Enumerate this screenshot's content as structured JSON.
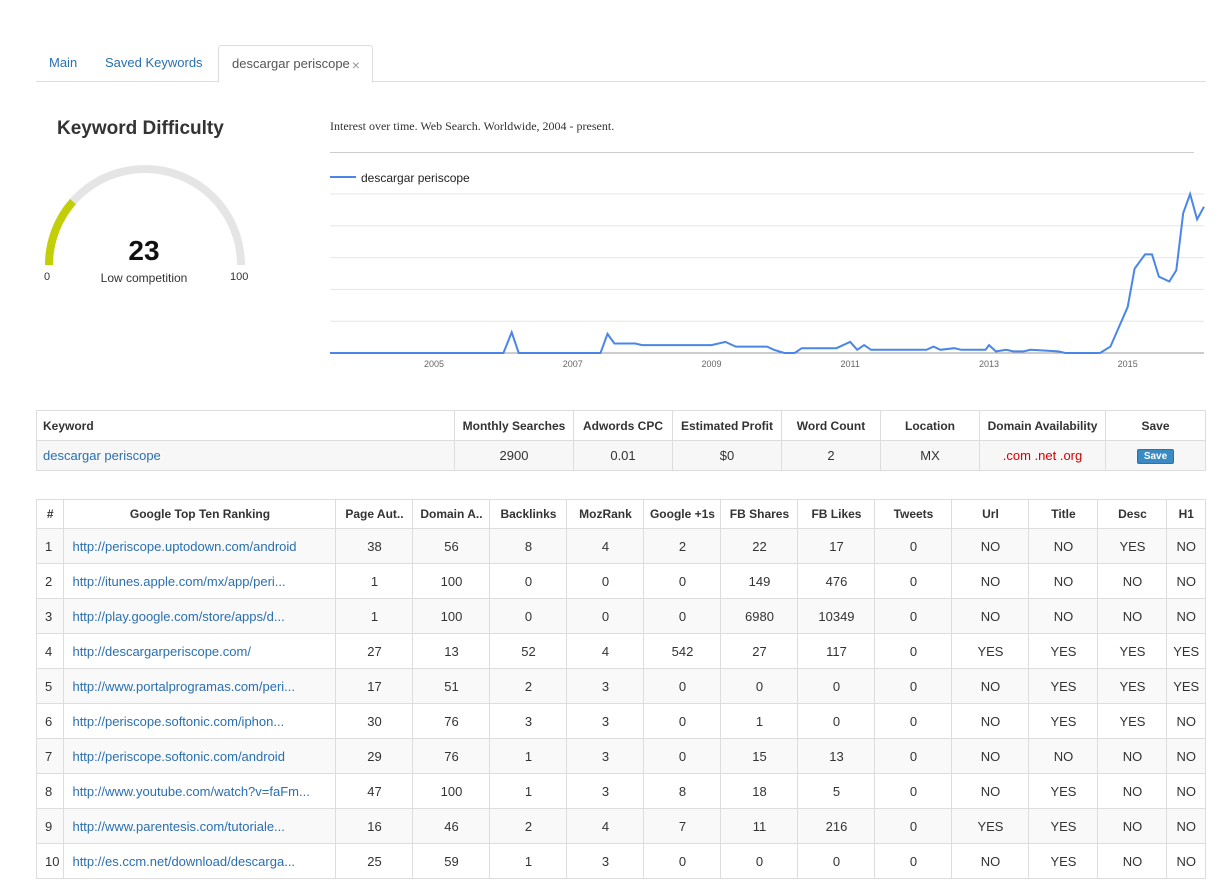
{
  "tabs": [
    {
      "label": "Main"
    },
    {
      "label": "Saved Keywords"
    },
    {
      "label": "descargar periscope",
      "close": "×"
    }
  ],
  "kd": {
    "title": "Keyword Difficulty",
    "value": "23",
    "fraction": 0.23,
    "label": "Low competition",
    "min": "0",
    "max": "100",
    "color_fill": "#c3cf06",
    "color_track": "#e5e5e5"
  },
  "trend": {
    "caption": "Interest over time. Web Search. Worldwide, 2004 - present.",
    "legend": "descargar periscope",
    "color": "#4a86e8",
    "years": [
      "2005",
      "2007",
      "2009",
      "2011",
      "2013",
      "2015"
    ]
  },
  "chart_data": {
    "type": "line",
    "x_range": [
      2004,
      2016.6
    ],
    "y_range": [
      0,
      100
    ],
    "series": [
      {
        "name": "descargar periscope",
        "points": [
          [
            2004.0,
            0
          ],
          [
            2006.5,
            0
          ],
          [
            2006.62,
            13
          ],
          [
            2006.72,
            0
          ],
          [
            2007.9,
            0
          ],
          [
            2008.0,
            12
          ],
          [
            2008.1,
            6
          ],
          [
            2008.4,
            6
          ],
          [
            2008.5,
            5
          ],
          [
            2009.5,
            5
          ],
          [
            2009.7,
            7
          ],
          [
            2009.85,
            4
          ],
          [
            2010.3,
            4
          ],
          [
            2010.4,
            2
          ],
          [
            2010.55,
            0
          ],
          [
            2010.7,
            0
          ],
          [
            2010.8,
            3
          ],
          [
            2011.3,
            3
          ],
          [
            2011.5,
            7
          ],
          [
            2011.6,
            2
          ],
          [
            2011.7,
            5
          ],
          [
            2011.8,
            2
          ],
          [
            2012.6,
            2
          ],
          [
            2012.7,
            4
          ],
          [
            2012.8,
            2
          ],
          [
            2013.0,
            3
          ],
          [
            2013.1,
            2
          ],
          [
            2013.45,
            2
          ],
          [
            2013.5,
            5
          ],
          [
            2013.6,
            1
          ],
          [
            2013.75,
            2
          ],
          [
            2013.85,
            1
          ],
          [
            2014.0,
            1
          ],
          [
            2014.1,
            2
          ],
          [
            2014.5,
            1
          ],
          [
            2014.6,
            0
          ],
          [
            2015.1,
            0
          ],
          [
            2015.25,
            4
          ],
          [
            2015.5,
            29
          ],
          [
            2015.6,
            53
          ],
          [
            2015.75,
            62
          ],
          [
            2015.85,
            62
          ],
          [
            2015.95,
            48
          ],
          [
            2016.1,
            45
          ],
          [
            2016.2,
            52
          ],
          [
            2016.3,
            88
          ],
          [
            2016.4,
            100
          ],
          [
            2016.5,
            84
          ],
          [
            2016.6,
            92
          ]
        ]
      }
    ]
  },
  "keyword_table": {
    "headers": [
      "Keyword",
      "Monthly Searches",
      "Adwords CPC",
      "Estimated Profit",
      "Word Count",
      "Location",
      "Domain Availability",
      "Save"
    ],
    "row": {
      "keyword": "descargar periscope",
      "monthly": "2900",
      "cpc": "0.01",
      "profit": "$0",
      "words": "2",
      "location": "MX",
      "domains": ".com .net .org",
      "save": "Save"
    }
  },
  "ranking": {
    "headers": [
      "#",
      "Google Top Ten Ranking",
      "Page Aut..",
      "Domain A..",
      "Backlinks",
      "MozRank",
      "Google +1s",
      "FB Shares",
      "FB Likes",
      "Tweets",
      "Url",
      "Title",
      "Desc",
      "H1"
    ],
    "rows": [
      [
        "1",
        "http://periscope.uptodown.com/android",
        "38",
        "56",
        "8",
        "4",
        "2",
        "22",
        "17",
        "0",
        "NO",
        "NO",
        "YES",
        "NO"
      ],
      [
        "2",
        "http://itunes.apple.com/mx/app/peri...",
        "1",
        "100",
        "0",
        "0",
        "0",
        "149",
        "476",
        "0",
        "NO",
        "NO",
        "NO",
        "NO"
      ],
      [
        "3",
        "http://play.google.com/store/apps/d...",
        "1",
        "100",
        "0",
        "0",
        "0",
        "6980",
        "10349",
        "0",
        "NO",
        "NO",
        "NO",
        "NO"
      ],
      [
        "4",
        "http://descargarperiscope.com/",
        "27",
        "13",
        "52",
        "4",
        "542",
        "27",
        "117",
        "0",
        "YES",
        "YES",
        "YES",
        "YES"
      ],
      [
        "5",
        "http://www.portalprogramas.com/peri...",
        "17",
        "51",
        "2",
        "3",
        "0",
        "0",
        "0",
        "0",
        "NO",
        "YES",
        "YES",
        "YES"
      ],
      [
        "6",
        "http://periscope.softonic.com/iphon...",
        "30",
        "76",
        "3",
        "3",
        "0",
        "1",
        "0",
        "0",
        "NO",
        "YES",
        "YES",
        "NO"
      ],
      [
        "7",
        "http://periscope.softonic.com/android",
        "29",
        "76",
        "1",
        "3",
        "0",
        "15",
        "13",
        "0",
        "NO",
        "NO",
        "NO",
        "NO"
      ],
      [
        "8",
        "http://www.youtube.com/watch?v=faFm...",
        "47",
        "100",
        "1",
        "3",
        "8",
        "18",
        "5",
        "0",
        "NO",
        "YES",
        "NO",
        "NO"
      ],
      [
        "9",
        "http://www.parentesis.com/tutoriale...",
        "16",
        "46",
        "2",
        "4",
        "7",
        "11",
        "216",
        "0",
        "YES",
        "YES",
        "NO",
        "NO"
      ],
      [
        "10",
        "http://es.ccm.net/download/descarga...",
        "25",
        "59",
        "1",
        "3",
        "0",
        "0",
        "0",
        "0",
        "NO",
        "YES",
        "NO",
        "NO"
      ]
    ]
  }
}
